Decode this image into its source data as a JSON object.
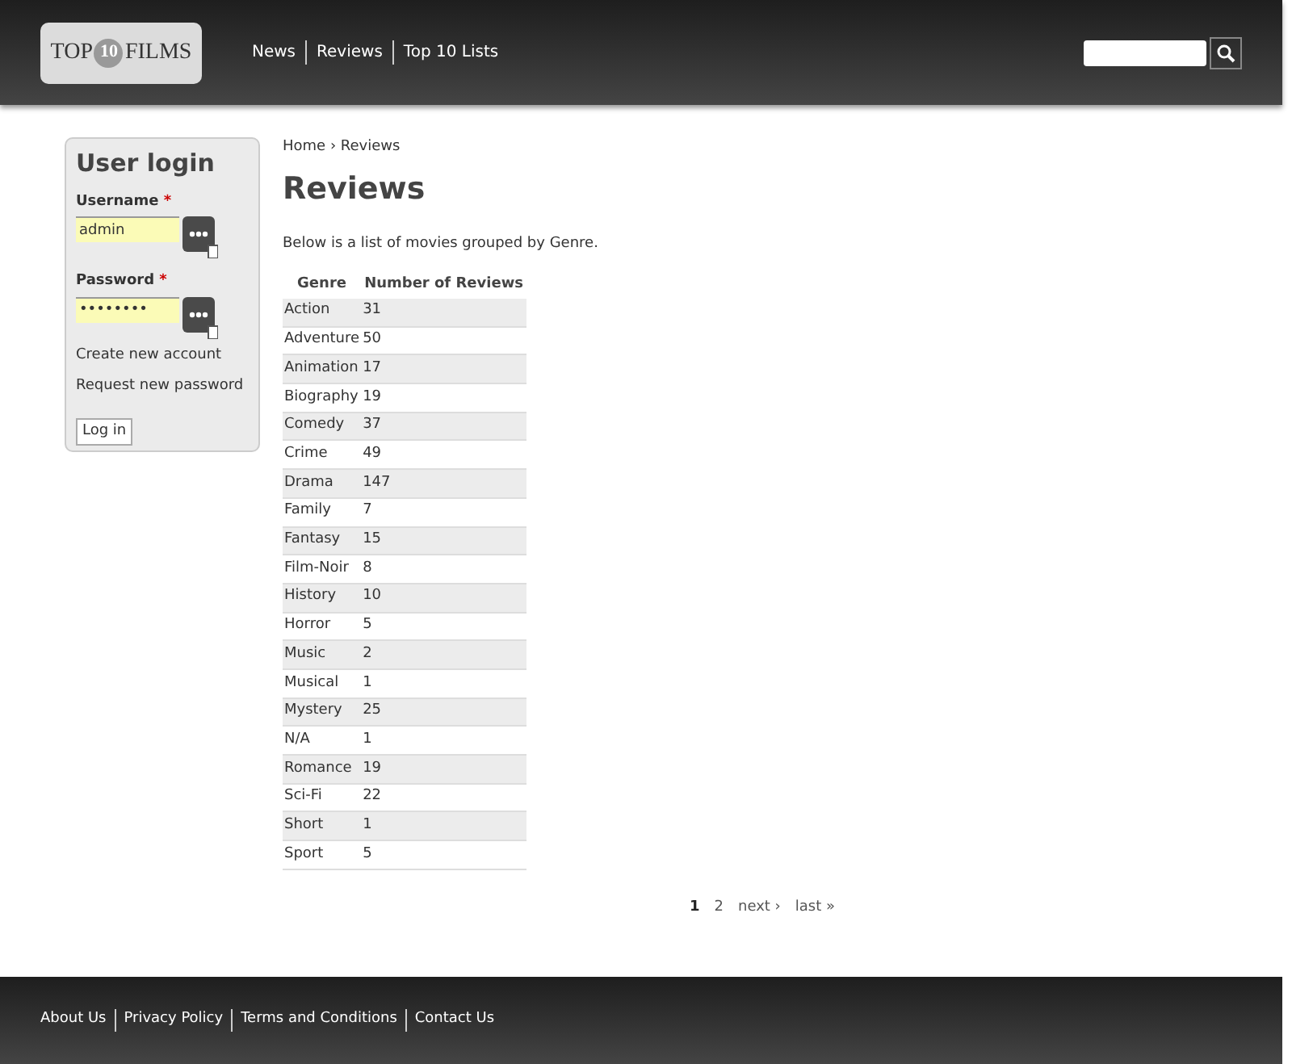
{
  "header": {
    "logo": {
      "left": "TOP",
      "badge": "10",
      "right": "FILMS"
    },
    "nav": [
      "News",
      "Reviews",
      "Top 10 Lists"
    ]
  },
  "login": {
    "title": "User login",
    "fields": [
      {
        "label": "Username",
        "required_mark": "*",
        "value": "admin"
      },
      {
        "label": "Password",
        "required_mark": "*",
        "value": "••••••••"
      }
    ],
    "links": [
      "Create new account",
      "Request new password"
    ],
    "button": "Log in"
  },
  "breadcrumb": "Home › Reviews",
  "title": "Reviews",
  "intro": "Below is a list of movies grouped by Genre.",
  "table": {
    "columns": [
      "Genre",
      "Number of Reviews"
    ],
    "rows": [
      [
        "Action",
        "31"
      ],
      [
        "Adventure",
        "50"
      ],
      [
        "Animation",
        "17"
      ],
      [
        "Biography",
        "19"
      ],
      [
        "Comedy",
        "37"
      ],
      [
        "Crime",
        "49"
      ],
      [
        "Drama",
        "147"
      ],
      [
        "Family",
        "7"
      ],
      [
        "Fantasy",
        "15"
      ],
      [
        "Film-Noir",
        "8"
      ],
      [
        "History",
        "10"
      ],
      [
        "Horror",
        "5"
      ],
      [
        "Music",
        "2"
      ],
      [
        "Musical",
        "1"
      ],
      [
        "Mystery",
        "25"
      ],
      [
        "N/A",
        "1"
      ],
      [
        "Romance",
        "19"
      ],
      [
        "Sci-Fi",
        "22"
      ],
      [
        "Short",
        "1"
      ],
      [
        "Sport",
        "5"
      ]
    ]
  },
  "pager": [
    {
      "label": "1",
      "selected": true
    },
    {
      "label": "2",
      "selected": false
    },
    {
      "label": "next ›",
      "selected": false
    },
    {
      "label": "last »",
      "selected": false
    }
  ],
  "footer": [
    "About Us",
    "Privacy Policy",
    "Terms and Conditions",
    "Contact Us"
  ]
}
